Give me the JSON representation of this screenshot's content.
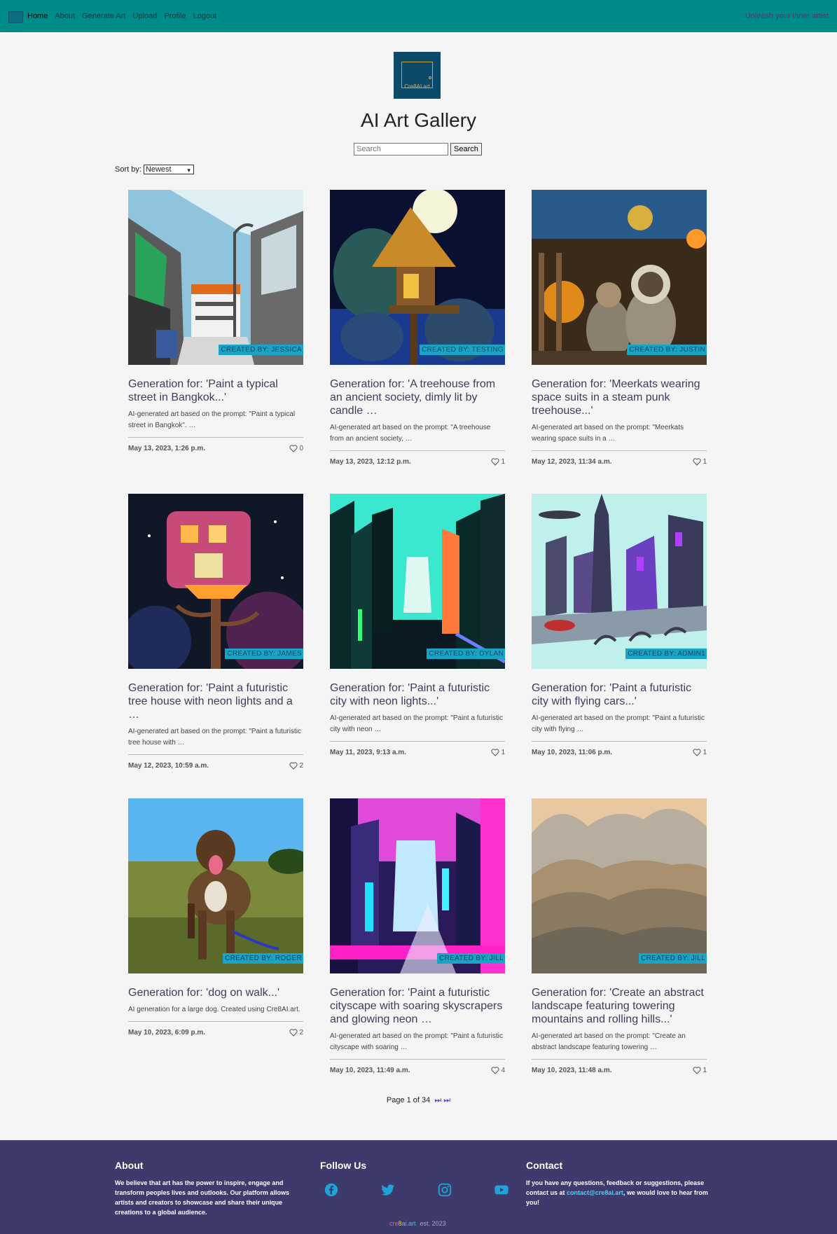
{
  "nav": {
    "links": [
      "Home",
      "About",
      "Generate Art",
      "Upload",
      "Profile",
      "Logout"
    ],
    "tagline": "Unleash your inner artist"
  },
  "header": {
    "logo_text": "Cre8AI.art",
    "title": "AI Art Gallery",
    "search_placeholder": "Search",
    "search_button": "Search",
    "sort_label": "Sort by:",
    "sort_value": "Newest"
  },
  "cards": [
    {
      "creator": "CREATED BY: JESSICA",
      "title": "Generation for: 'Paint a typical street in Bangkok...'",
      "desc": "AI-generated art based on the prompt: \"Paint a typical street in Bangkok\". …",
      "date": "May 13, 2023, 1:26 p.m.",
      "likes": "0"
    },
    {
      "creator": "CREATED BY: TESTING",
      "title": "Generation for: 'A treehouse from an ancient society, dimly lit by candle …",
      "desc": "AI-generated art based on the prompt: \"A treehouse from an ancient society, …",
      "date": "May 13, 2023, 12:12 p.m.",
      "likes": "1"
    },
    {
      "creator": "CREATED BY: JUSTIN",
      "title": "Generation for: 'Meerkats wearing space suits in a steam punk treehouse...'",
      "desc": "AI-generated art based on the prompt: \"Meerkats wearing space suits in a …",
      "date": "May 12, 2023, 11:34 a.m.",
      "likes": "1"
    },
    {
      "creator": "CREATED BY: JAMES",
      "title": "Generation for: 'Paint a futuristic tree house with neon lights and a …",
      "desc": "AI-generated art based on the prompt: \"Paint a futuristic tree house with …",
      "date": "May 12, 2023, 10:59 a.m.",
      "likes": "2"
    },
    {
      "creator": "CREATED BY: DYLAN",
      "title": "Generation for: 'Paint a futuristic city with neon lights...'",
      "desc": "AI-generated art based on the prompt: \"Paint a futuristic city with neon …",
      "date": "May 11, 2023, 9:13 a.m.",
      "likes": "1"
    },
    {
      "creator": "CREATED BY: ADMIN1",
      "title": "Generation for: 'Paint a futuristic city with flying cars...'",
      "desc": "AI-generated art based on the prompt: \"Paint a futuristic city with flying …",
      "date": "May 10, 2023, 11:06 p.m.",
      "likes": "1"
    },
    {
      "creator": "CREATED BY: ROGER",
      "title": "Generation for: 'dog on walk...'",
      "desc": "AI generation for a large dog. Created using Cre8AI.art.",
      "date": "May 10, 2023, 6:09 p.m.",
      "likes": "2"
    },
    {
      "creator": "CREATED BY: JILL",
      "title": "Generation for: 'Paint a futuristic cityscape with soaring skyscrapers and glowing neon …",
      "desc": "AI-generated art based on the prompt: \"Paint a futuristic cityscape with soaring …",
      "date": "May 10, 2023, 11:49 a.m.",
      "likes": "4"
    },
    {
      "creator": "CREATED BY: JILL",
      "title": "Generation for: 'Create an abstract landscape featuring towering mountains and rolling hills...'",
      "desc": "AI-generated art based on the prompt: \"Create an abstract landscape featuring towering …",
      "date": "May 10, 2023, 11:48 a.m.",
      "likes": "1"
    }
  ],
  "pagination": {
    "text": "Page 1 of 34"
  },
  "footer": {
    "about_title": "About",
    "about_text": "We believe that art has the power to inspire, engage and transform peoples lives and outlooks. Our platform allows artists and creators to showcase and share their unique creations to a global audience.",
    "follow_title": "Follow Us",
    "contact_title": "Contact",
    "contact_text": "If you have any questions, feedback or suggestions, please contact us at",
    "contact_email": "contact@cre8ai.art",
    "contact_text_end": ", we would love to hear from you!",
    "brand_a": "cre",
    "brand_b": "8",
    "brand_c": "ai.art",
    "est": "est. 2023"
  },
  "colors": {
    "nav": "#008b8b",
    "footer": "#3d3b6b",
    "badge": "#1aa3c4",
    "accent": "#6a3fd0"
  }
}
